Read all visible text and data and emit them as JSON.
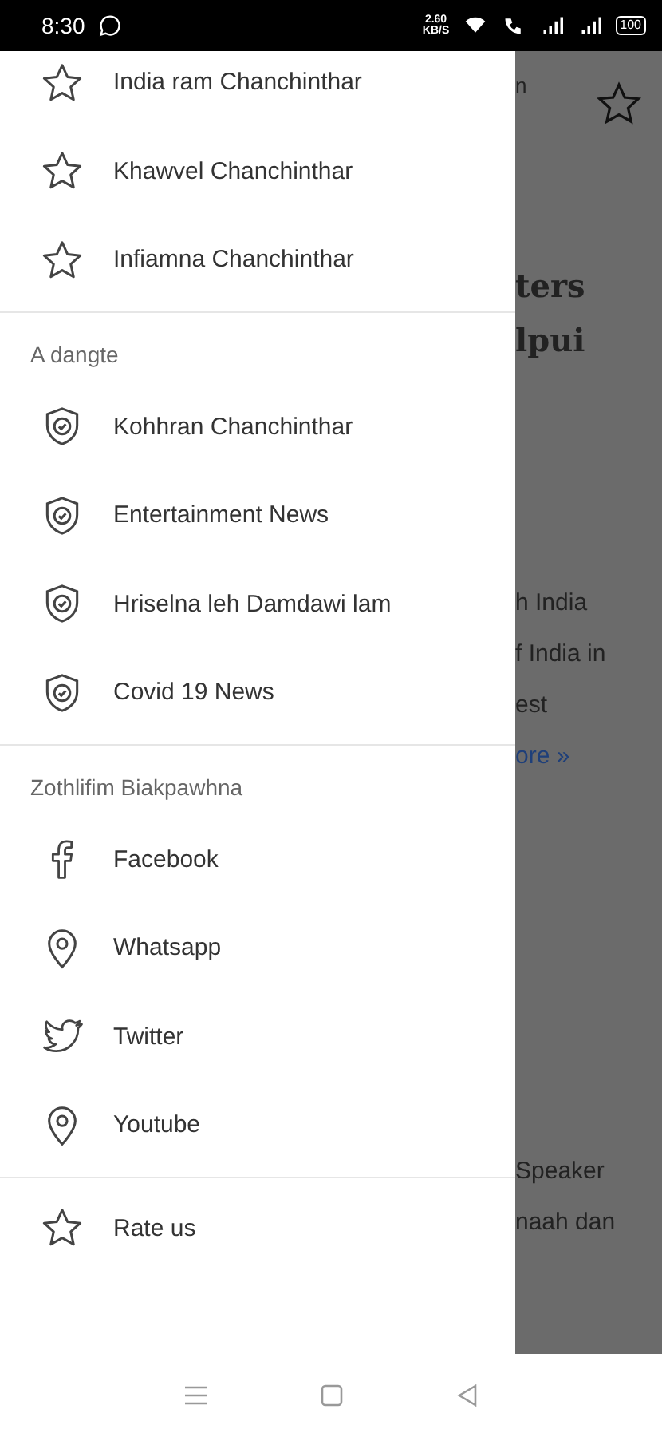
{
  "status_bar": {
    "time": "8:30",
    "speed": "2.60",
    "speed_unit": "KB/S",
    "battery": "100"
  },
  "drawer": {
    "sections": [
      {
        "items": [
          {
            "label": "India ram Chanchinthar",
            "kind": "star"
          },
          {
            "label": "Khawvel Chanchinthar",
            "kind": "star"
          },
          {
            "label": "Infiamna Chanchinthar",
            "kind": "star"
          }
        ]
      },
      {
        "header": "A dangte",
        "items": [
          {
            "label": "Kohhran Chanchinthar",
            "kind": "shield"
          },
          {
            "label": "Entertainment News",
            "kind": "shield"
          },
          {
            "label": "Hriselna leh Damdawi lam",
            "kind": "shield"
          },
          {
            "label": "Covid 19 News",
            "kind": "shield"
          }
        ]
      },
      {
        "header": "Zothlifim Biakpawhna",
        "items": [
          {
            "label": "Facebook",
            "kind": "facebook"
          },
          {
            "label": "Whatsapp",
            "kind": "pin"
          },
          {
            "label": "Twitter",
            "kind": "bird"
          },
          {
            "label": "Youtube",
            "kind": "pin"
          }
        ]
      },
      {
        "items": [
          {
            "label": "Rate us",
            "kind": "star"
          }
        ]
      }
    ]
  },
  "background": {
    "fragments": [
      {
        "text": "n",
        "kind": "small"
      },
      {
        "text": "ters",
        "kind": "heading"
      },
      {
        "text": "lpui",
        "kind": "heading"
      },
      {
        "text": "h India",
        "kind": "body"
      },
      {
        "text": "f India in",
        "kind": "body"
      },
      {
        "text": "est",
        "kind": "body"
      },
      {
        "text": "ore »",
        "kind": "link"
      },
      {
        "text": "Speaker",
        "kind": "body"
      },
      {
        "text": "naah dan",
        "kind": "body"
      }
    ]
  }
}
